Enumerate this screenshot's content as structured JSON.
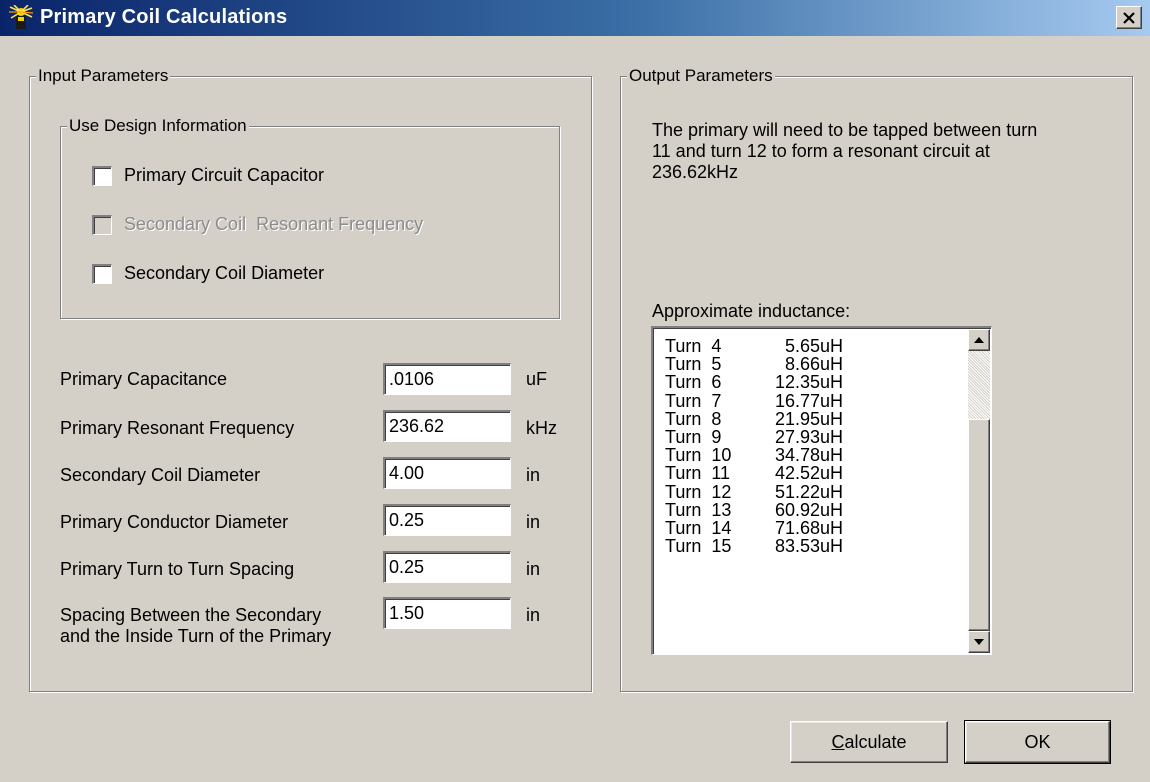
{
  "window": {
    "title": "Primary Coil Calculations",
    "icon": "tesla-coil-app-icon",
    "close_label": "close"
  },
  "input_group": {
    "title": "Input Parameters",
    "design_group": {
      "title": "Use Design Information",
      "checkboxes": [
        {
          "label": "Primary Circuit Capacitor",
          "checked": false,
          "enabled": true
        },
        {
          "label": "Secondary Coil  Resonant Frequency",
          "checked": false,
          "enabled": false
        },
        {
          "label": "Secondary Coil Diameter",
          "checked": false,
          "enabled": true
        }
      ]
    },
    "params": [
      {
        "label": "Primary Capacitance",
        "value": ".0106",
        "unit": "uF"
      },
      {
        "label": "Primary Resonant Frequency",
        "value": "236.62",
        "unit": "kHz"
      },
      {
        "label": "Secondary Coil Diameter",
        "value": "4.00",
        "unit": "in"
      },
      {
        "label": "Primary Conductor Diameter",
        "value": "0.25",
        "unit": "in"
      },
      {
        "label": "Primary Turn to Turn Spacing",
        "value": "0.25",
        "unit": "in"
      },
      {
        "label": "Spacing Between the Secondary",
        "label2": "and the Inside Turn of the Primary",
        "value": "1.50",
        "unit": "in"
      }
    ]
  },
  "output_group": {
    "title": "Output Parameters",
    "message_line1": "The primary will need to be tapped between turn",
    "message_line2": "11 and turn 12 to form a resonant circuit at",
    "message_line3": "236.62kHz",
    "inductance_label": "Approximate inductance:",
    "inductance_list": [
      {
        "turn": "Turn  4",
        "value": "5.65uH"
      },
      {
        "turn": "Turn  5",
        "value": "8.66uH"
      },
      {
        "turn": "Turn  6",
        "value": "12.35uH"
      },
      {
        "turn": "Turn  7",
        "value": "16.77uH"
      },
      {
        "turn": "Turn  8",
        "value": "21.95uH"
      },
      {
        "turn": "Turn  9",
        "value": "27.93uH"
      },
      {
        "turn": "Turn  10",
        "value": "34.78uH"
      },
      {
        "turn": "Turn  11",
        "value": "42.52uH"
      },
      {
        "turn": "Turn  12",
        "value": "51.22uH"
      },
      {
        "turn": "Turn  13",
        "value": "60.92uH"
      },
      {
        "turn": "Turn  14",
        "value": "71.68uH"
      },
      {
        "turn": "Turn  15",
        "value": "83.53uH"
      }
    ]
  },
  "buttons": {
    "calculate": "Calculate",
    "calculate_hotkey": "C",
    "calculate_rest": "alculate",
    "ok": "OK"
  },
  "colors": {
    "face": "#d4d0c8",
    "title_start": "#0a246a",
    "title_end": "#a6caf0"
  }
}
